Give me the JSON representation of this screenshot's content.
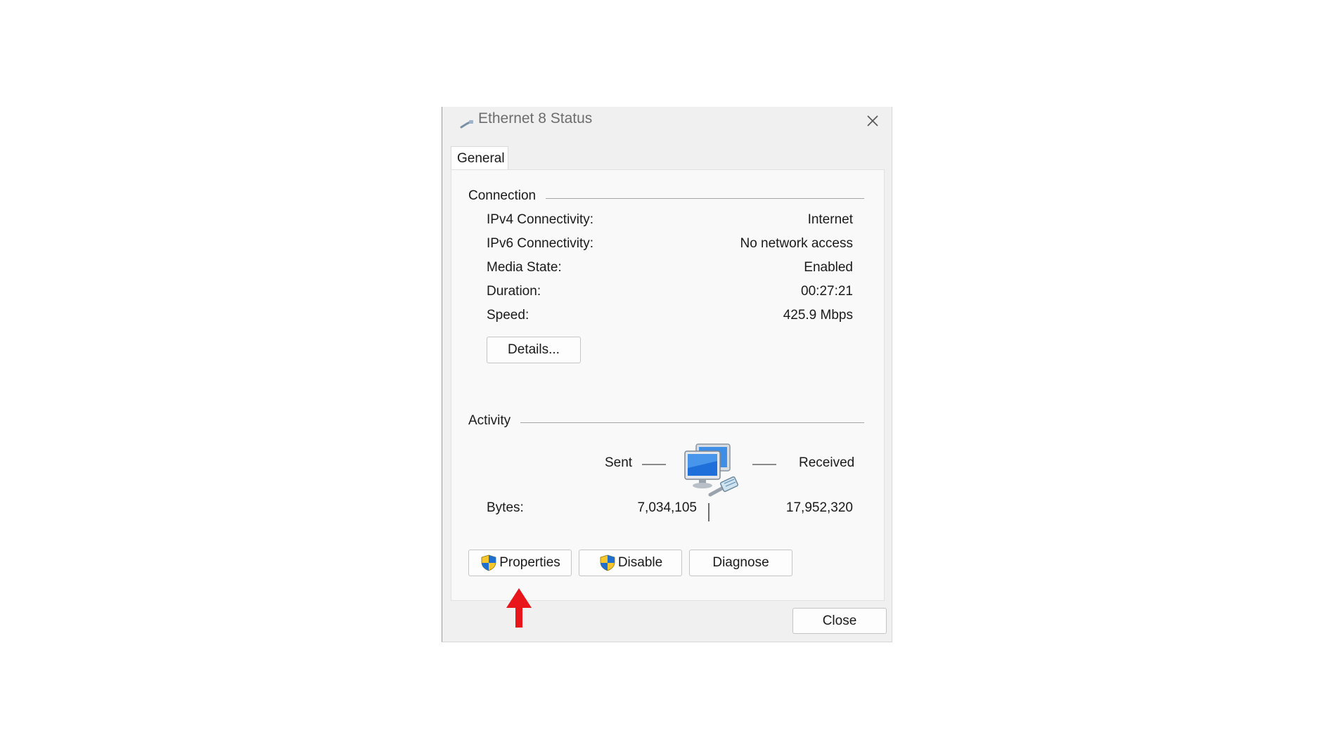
{
  "window": {
    "title": "Ethernet 8 Status"
  },
  "tabs": [
    {
      "label": "General"
    }
  ],
  "connection": {
    "group_title": "Connection",
    "rows": [
      {
        "label": "IPv4 Connectivity:",
        "value": "Internet"
      },
      {
        "label": "IPv6 Connectivity:",
        "value": "No network access"
      },
      {
        "label": "Media State:",
        "value": "Enabled"
      },
      {
        "label": "Duration:",
        "value": "00:27:21"
      },
      {
        "label": "Speed:",
        "value": "425.9 Mbps"
      }
    ],
    "details_label": "Details..."
  },
  "activity": {
    "group_title": "Activity",
    "sent_label": "Sent",
    "received_label": "Received",
    "bytes_label": "Bytes:",
    "bytes_sent": "7,034,105",
    "bytes_received": "17,952,320"
  },
  "buttons": {
    "properties": "Properties",
    "disable": "Disable",
    "diagnose": "Diagnose",
    "close": "Close"
  },
  "icons": {
    "title_icon": "ethernet-cable-icon",
    "network_icon": "network-computers-icon",
    "shield_icon": "uac-shield-icon",
    "annotation": "red-arrow-icon"
  },
  "colors": {
    "annotation_arrow": "#e8161b",
    "dialog_bg": "#f0f0f0",
    "panel_bg": "#f9f9f9"
  }
}
